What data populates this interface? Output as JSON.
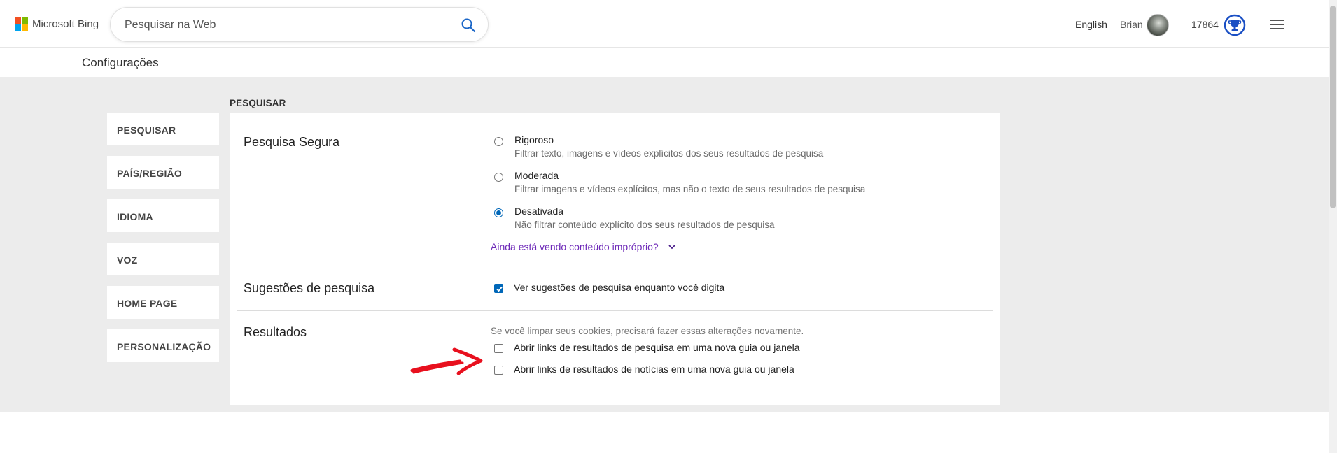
{
  "header": {
    "logo_text": "Microsoft Bing",
    "logo_colors": [
      "#f25022",
      "#7fba00",
      "#00a4ef",
      "#ffb900"
    ],
    "search_placeholder": "Pesquisar na Web",
    "search_icon": "search-icon",
    "language": "English",
    "user_name": "Brian",
    "points": "17864",
    "rewards_icon": "rewards-trophy-icon",
    "menu_icon": "hamburger-menu-icon"
  },
  "page_title": "Configurações",
  "sidebar": {
    "items": [
      {
        "label": "PESQUISAR"
      },
      {
        "label": "PAÍS/REGIÃO"
      },
      {
        "label": "IDIOMA"
      },
      {
        "label": "VOZ"
      },
      {
        "label": "HOME PAGE"
      },
      {
        "label": "PERSONALIZAÇÃO"
      }
    ]
  },
  "section_label": "PESQUISAR",
  "safe_search": {
    "title": "Pesquisa Segura",
    "selected": "Desativada",
    "options": [
      {
        "label": "Rigoroso",
        "desc": "Filtrar texto, imagens e vídeos explícitos dos seus resultados de pesquisa"
      },
      {
        "label": "Moderada",
        "desc": "Filtrar imagens e vídeos explícitos, mas não o texto de seus resultados de pesquisa"
      },
      {
        "label": "Desativada",
        "desc": "Não filtrar conteúdo explícito dos seus resultados de pesquisa"
      }
    ],
    "more_link": "Ainda está vendo conteúdo impróprio?"
  },
  "suggestions": {
    "title": "Sugestões de pesquisa",
    "checkbox_label": "Ver sugestões de pesquisa enquanto você digita",
    "checked": true
  },
  "results": {
    "title": "Resultados",
    "note": "Se você limpar seus cookies, precisará fazer essas alterações novamente.",
    "options": [
      {
        "label": "Abrir links de resultados de pesquisa em uma nova guia ou janela",
        "checked": false
      },
      {
        "label": "Abrir links de resultados de notícias em uma nova guia ou janela",
        "checked": false
      }
    ]
  },
  "colors": {
    "accent": "#0067b8",
    "link": "#6e2ab8",
    "annotation": "#e8101e",
    "background": "#ececec"
  }
}
